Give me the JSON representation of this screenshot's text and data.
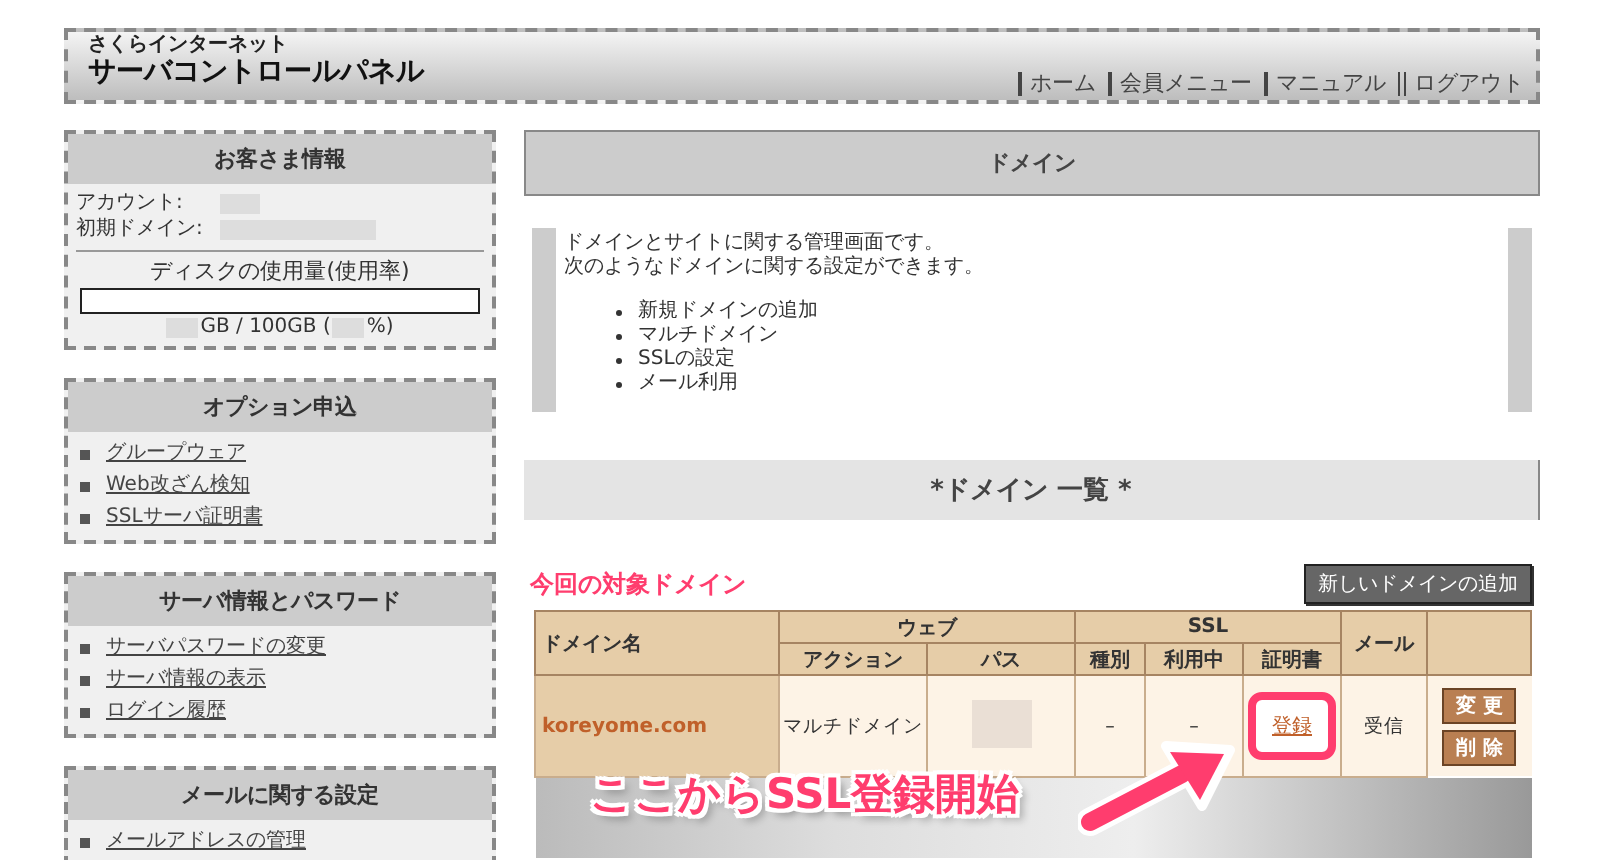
{
  "header": {
    "brand_small": "さくらインターネット",
    "brand": "サーバコントロールパネル",
    "nav": [
      "ホーム",
      "会員メニュー",
      "マニュアル",
      "ログアウト"
    ]
  },
  "customer_info": {
    "title": "お客さま情報",
    "fields": [
      {
        "label": "アカウント:"
      },
      {
        "label": "初期ドメイン:"
      }
    ],
    "disk_label": "ディスクの使用量(使用率)",
    "disk_text_1": "GB / 100GB (",
    "disk_text_2": "%)"
  },
  "menus": [
    {
      "title": "オプション申込",
      "items": [
        "グループウェア",
        "Web改ざん検知",
        "SSLサーバ証明書"
      ]
    },
    {
      "title": "サーバ情報とパスワード",
      "items": [
        "サーバパスワードの変更",
        "サーバ情報の表示",
        "ログイン履歴"
      ]
    },
    {
      "title": "メールに関する設定",
      "items": [
        "メールアドレスの管理"
      ]
    }
  ],
  "main": {
    "title": "ドメイン",
    "intro": [
      "ドメインとサイトに関する管理画面です。",
      "次のようなドメインに関する設定ができます。"
    ],
    "bullets": [
      "新規ドメインの追加",
      "マルチドメイン",
      "SSLの設定",
      "メール利用"
    ],
    "list_title": "*ドメイン 一覧 *",
    "target_label": "今回の対象ドメイン",
    "add_button": "新しいドメインの追加",
    "table": {
      "headers": {
        "domain": "ドメイン名",
        "web": "ウェブ",
        "ssl": "SSL",
        "mail": "メール",
        "action": "アクション",
        "path": "パス",
        "type": "種別",
        "in_use": "利用中",
        "cert": "証明書"
      },
      "rows": [
        {
          "domain": "koreyome.com",
          "action": "マルチドメイン",
          "type": "–",
          "in_use": "–",
          "cert": "登録",
          "mail": "受信",
          "buttons": [
            "変 更",
            "削 除"
          ]
        }
      ]
    },
    "annotation": "ここからSSL登録開始"
  }
}
